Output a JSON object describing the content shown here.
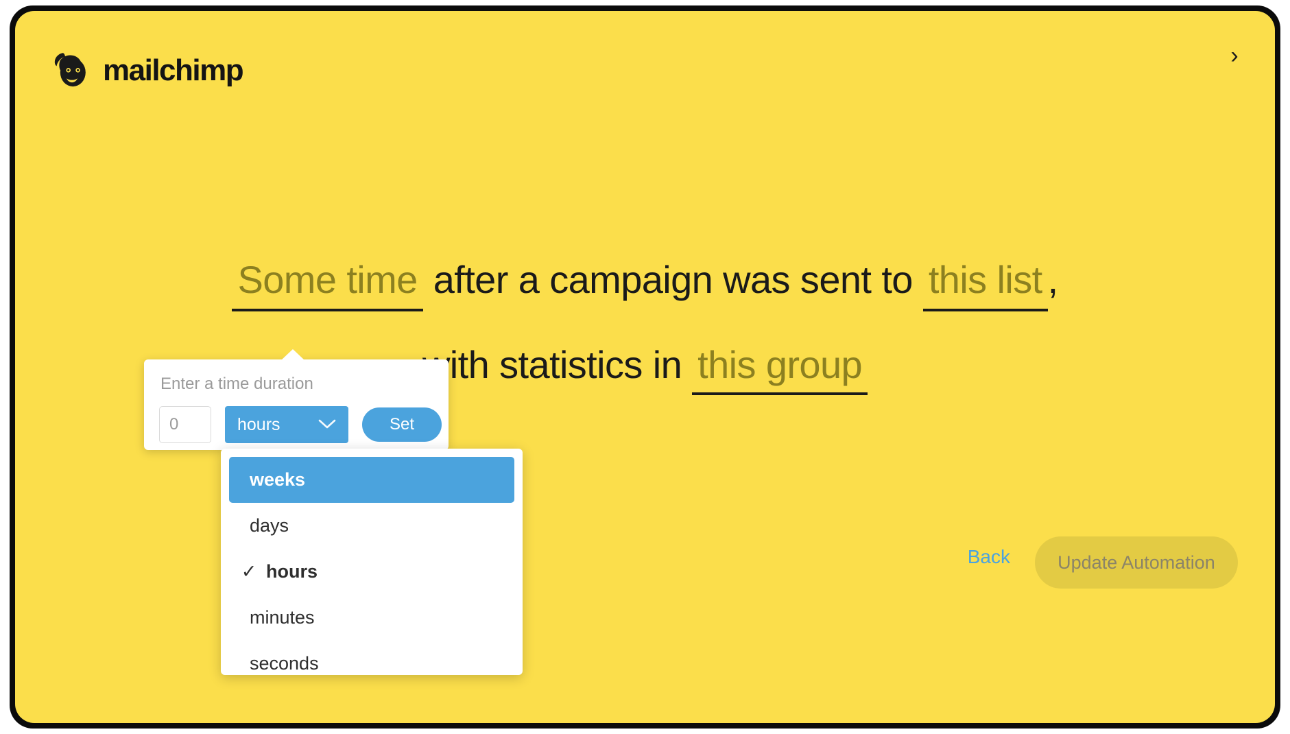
{
  "brand": {
    "name": "mailchimp",
    "logo_icon": "mailchimp-monkey-icon",
    "page_background": "#fbde4b"
  },
  "header": {
    "close_icon": "chevron-right-icon",
    "close_glyph": "›"
  },
  "sentence": {
    "line1": {
      "blank_time": "Some time",
      "static_mid": "after a campaign was sent to",
      "blank_list": "this list",
      "trailing": ","
    },
    "line2": {
      "static_start": "with statistics in",
      "blank_group": "this group"
    }
  },
  "popover": {
    "label": "Enter a time duration",
    "amount_value": "",
    "amount_placeholder": "0",
    "unit_selected": "hours",
    "chevron_glyph": "⌄",
    "set_label": "Set"
  },
  "dropdown": {
    "options": [
      {
        "label": "weeks",
        "state": "highlighted"
      },
      {
        "label": "days",
        "state": "normal"
      },
      {
        "label": "hours",
        "state": "checked"
      },
      {
        "label": "minutes",
        "state": "normal"
      },
      {
        "label": "seconds",
        "state": "clipped"
      }
    ],
    "check_glyph": "✓"
  },
  "footer": {
    "back_label": "Back",
    "update_label": "Update Automation"
  },
  "colors": {
    "yellow": "#fbde4b",
    "blue": "#4ba3dd",
    "blank_text": "#8c8020",
    "link_blue": "#4aa3e0",
    "disabled_button_text": "#8b8468"
  }
}
